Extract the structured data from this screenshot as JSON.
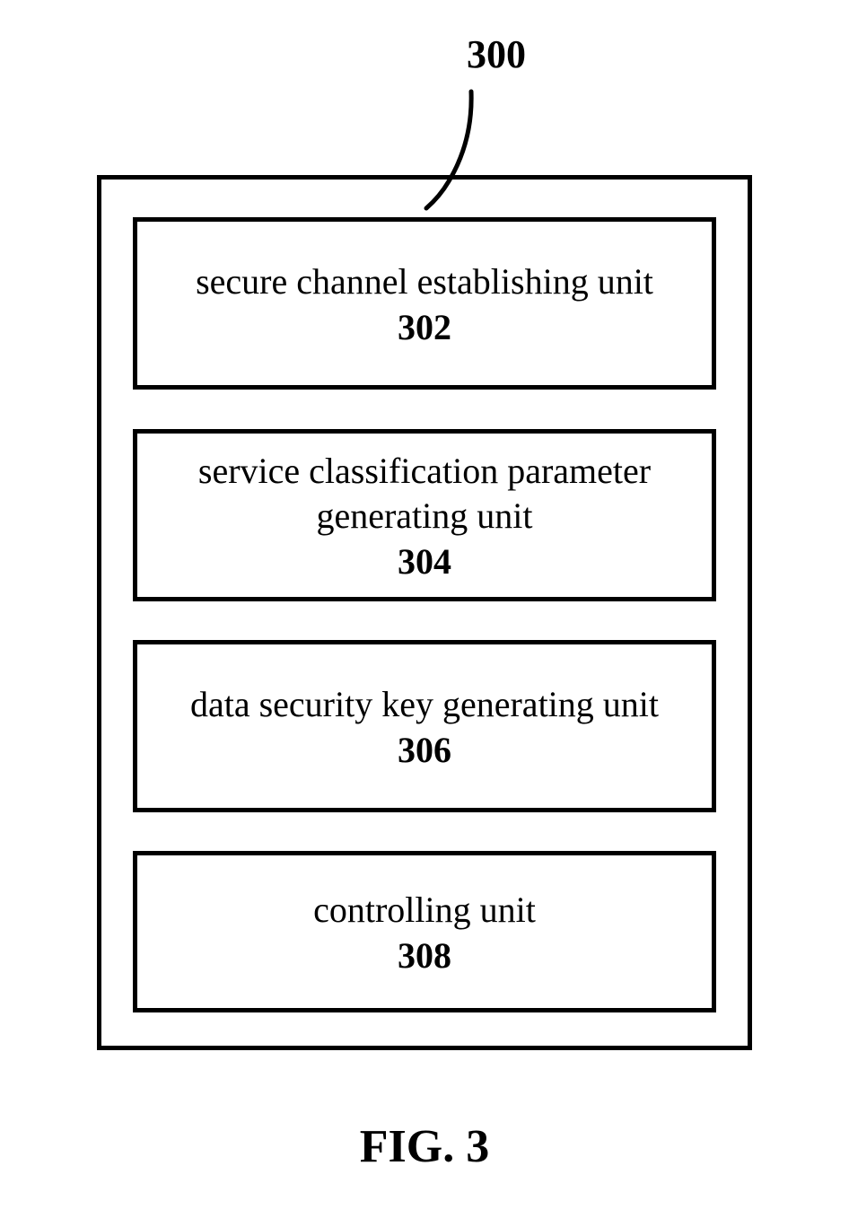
{
  "callout_number": "300",
  "boxes": [
    {
      "label": "secure channel establishing unit",
      "number": "302"
    },
    {
      "label": "service classification parameter generating unit",
      "number": "304"
    },
    {
      "label": "data security key generating unit",
      "number": "306"
    },
    {
      "label": "controlling unit",
      "number": "308"
    }
  ],
  "figure_label": "FIG. 3"
}
